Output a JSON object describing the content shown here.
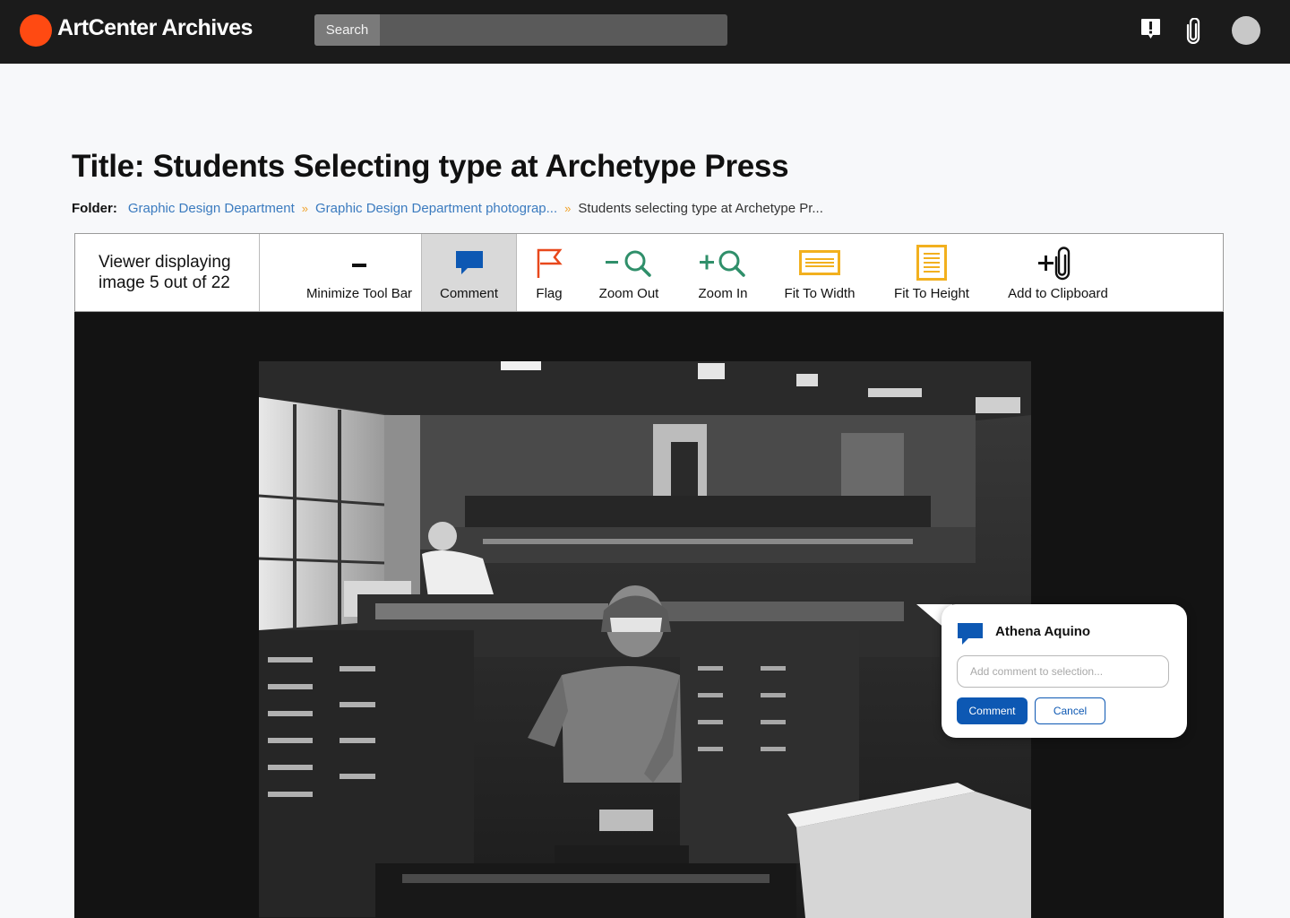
{
  "app": {
    "title": "ArtCenter Archives"
  },
  "search": {
    "button_label": "Search",
    "placeholder": ""
  },
  "header": {
    "title": "Title: Students Selecting type at Archetype Press",
    "folder_label": "Folder:",
    "breadcrumbs": [
      "Graphic Design Department",
      "Graphic Design Department photograp...",
      "Students selecting type at Archetype Pr..."
    ]
  },
  "viewer_status": {
    "line1": "Viewer displaying",
    "line2": "image 5 out of 22"
  },
  "toolbar": {
    "minimize": "Minimize Tool Bar",
    "comment": "Comment",
    "flag": "Flag",
    "zoom_out": "Zoom Out",
    "zoom_in": "Zoom In",
    "fit_width": "Fit To Width",
    "fit_height": "Fit To Height",
    "add_clipboard": "Add to Clipboard"
  },
  "icons": {
    "comment": "speech-bubble-icon",
    "flag": "flag-icon",
    "zoom_out": "zoom-out-icon",
    "zoom_in": "zoom-in-icon",
    "fit_width": "fit-width-icon",
    "fit_height": "fit-height-icon",
    "clipboard": "paperclip-plus-icon"
  },
  "colors": {
    "brand": "#ff4a12",
    "topbar": "#1b1b1b",
    "link": "#3b7bbf",
    "accent_blue": "#0d58b3",
    "flag": "#e8481c",
    "zoom": "#2f8f6a",
    "fit": "#f2b01e"
  },
  "comment_popup": {
    "user": "Athena Aquino",
    "placeholder": "Add comment to selection...",
    "submit": "Comment",
    "cancel": "Cancel"
  }
}
